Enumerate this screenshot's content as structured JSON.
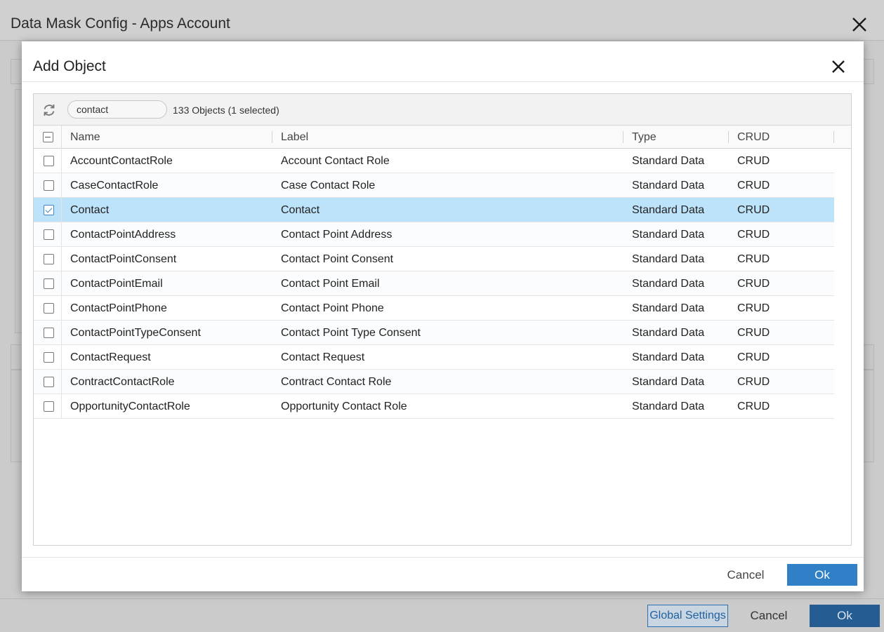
{
  "outer": {
    "title": "Data Mask Config - Apps Account",
    "global_settings_label": "Global Settings",
    "cancel_label": "Cancel",
    "ok_label": "Ok"
  },
  "modal": {
    "title": "Add Object",
    "search_value": "contact",
    "count_text": "133 Objects (1 selected)",
    "columns": {
      "name": "Name",
      "label": "Label",
      "type": "Type",
      "crud": "CRUD"
    },
    "rows": [
      {
        "name": "AccountContactRole",
        "label": "Account Contact Role",
        "type": "Standard Data",
        "crud": "CRUD",
        "checked": false
      },
      {
        "name": "CaseContactRole",
        "label": "Case Contact Role",
        "type": "Standard Data",
        "crud": "CRUD",
        "checked": false
      },
      {
        "name": "Contact",
        "label": "Contact",
        "type": "Standard Data",
        "crud": "CRUD",
        "checked": true
      },
      {
        "name": "ContactPointAddress",
        "label": "Contact Point Address",
        "type": "Standard Data",
        "crud": "CRUD",
        "checked": false
      },
      {
        "name": "ContactPointConsent",
        "label": "Contact Point Consent",
        "type": "Standard Data",
        "crud": "CRUD",
        "checked": false
      },
      {
        "name": "ContactPointEmail",
        "label": "Contact Point Email",
        "type": "Standard Data",
        "crud": "CRUD",
        "checked": false
      },
      {
        "name": "ContactPointPhone",
        "label": "Contact Point Phone",
        "type": "Standard Data",
        "crud": "CRUD",
        "checked": false
      },
      {
        "name": "ContactPointTypeConsent",
        "label": "Contact Point Type Consent",
        "type": "Standard Data",
        "crud": "CRUD",
        "checked": false
      },
      {
        "name": "ContactRequest",
        "label": "Contact Request",
        "type": "Standard Data",
        "crud": "CRUD",
        "checked": false
      },
      {
        "name": "ContractContactRole",
        "label": "Contract Contact Role",
        "type": "Standard Data",
        "crud": "CRUD",
        "checked": false
      },
      {
        "name": "OpportunityContactRole",
        "label": "Opportunity Contact Role",
        "type": "Standard Data",
        "crud": "CRUD",
        "checked": false
      }
    ],
    "cancel_label": "Cancel",
    "ok_label": "Ok"
  },
  "icons": {
    "close": "close-icon",
    "refresh": "refresh-icon",
    "checkbox": "checkbox-icon"
  },
  "colors": {
    "selected_row": "#bde3fa",
    "primary_button": "#2f80c6",
    "checkbox_checked": "#3d85c6"
  }
}
